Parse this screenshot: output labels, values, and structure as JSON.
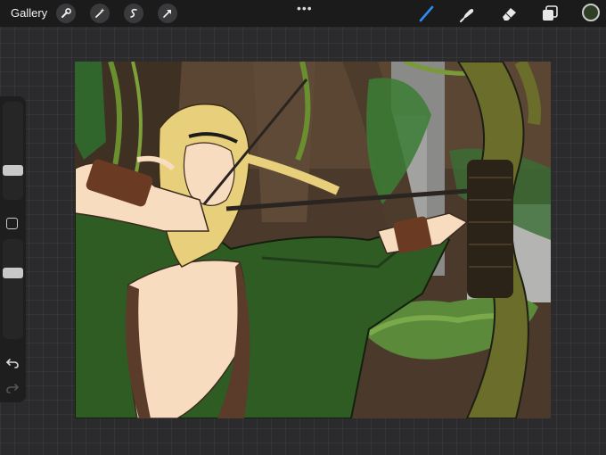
{
  "topbar": {
    "gallery_label": "Gallery",
    "tools": [
      {
        "name": "actions",
        "icon": "wrench-icon"
      },
      {
        "name": "adjustments",
        "icon": "magic-wand-icon"
      },
      {
        "name": "selection",
        "icon": "selection-icon"
      },
      {
        "name": "transform",
        "icon": "arrow-icon"
      }
    ],
    "more_label": "•••",
    "right_tools": [
      {
        "name": "brush",
        "icon": "brush-icon",
        "active": true
      },
      {
        "name": "smudge",
        "icon": "smudge-icon",
        "active": false
      },
      {
        "name": "eraser",
        "icon": "eraser-icon",
        "active": false
      },
      {
        "name": "layers",
        "icon": "layers-icon",
        "active": false
      }
    ],
    "current_color": "#2f3f25",
    "accent_color": "#2d8cf0"
  },
  "sidebar": {
    "brush_size_level": 0.3,
    "opacity_level": 0.4,
    "modify_icon": "square-icon",
    "undo_icon": "undo-icon",
    "redo_icon": "redo-icon"
  },
  "canvas": {
    "description_icon": "artwork-canvas"
  }
}
